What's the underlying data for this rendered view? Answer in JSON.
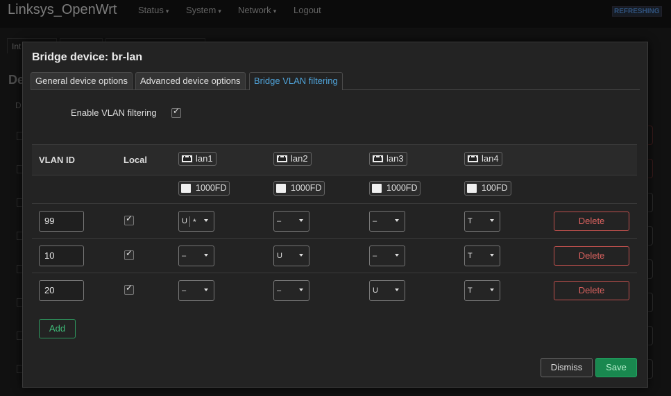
{
  "app": {
    "brand": "Linksys_OpenWrt",
    "menu": [
      {
        "label": "Status",
        "caret": "▾"
      },
      {
        "label": "System",
        "caret": "▾"
      },
      {
        "label": "Network",
        "caret": "▾"
      },
      {
        "label": "Logout",
        "caret": ""
      }
    ],
    "refresh_badge": "REFRESHING",
    "bg_tab_label": "Int",
    "bg_heading": "De",
    "bg_subheading": "D"
  },
  "modal": {
    "title": "Bridge device: br-lan",
    "tabs": [
      {
        "label": "General device options",
        "active": false
      },
      {
        "label": "Advanced device options",
        "active": false
      },
      {
        "label": "Bridge VLAN filtering",
        "active": true
      }
    ],
    "enable_vlan_filtering": {
      "label": "Enable VLAN filtering",
      "checked": true
    },
    "table": {
      "col_vlan_id": "VLAN ID",
      "col_local": "Local",
      "ports": [
        {
          "name": "lan1",
          "speed": "1000FD",
          "icon": "ethernet-port-icon"
        },
        {
          "name": "lan2",
          "speed": "1000FD",
          "icon": "ethernet-port-icon"
        },
        {
          "name": "lan3",
          "speed": "1000FD",
          "icon": "ethernet-port-icon"
        },
        {
          "name": "lan4",
          "speed": "100FD",
          "icon": "ethernet-port-icon"
        }
      ],
      "rows": [
        {
          "vlan_id": "99",
          "local": true,
          "ports": [
            "U",
            "–",
            "–",
            "T"
          ],
          "lan1_flag": "*",
          "delete_label": "Delete"
        },
        {
          "vlan_id": "10",
          "local": true,
          "ports": [
            "–",
            "U",
            "–",
            "T"
          ],
          "delete_label": "Delete"
        },
        {
          "vlan_id": "20",
          "local": true,
          "ports": [
            "–",
            "–",
            "U",
            "T"
          ],
          "delete_label": "Delete"
        }
      ]
    },
    "add_label": "Add",
    "dismiss_label": "Dismiss",
    "save_label": "Save",
    "colors": {
      "accent_tab": "#4fa3d9",
      "delete": "#c0504d",
      "save": "#19884f",
      "add": "#2e9a60"
    }
  }
}
